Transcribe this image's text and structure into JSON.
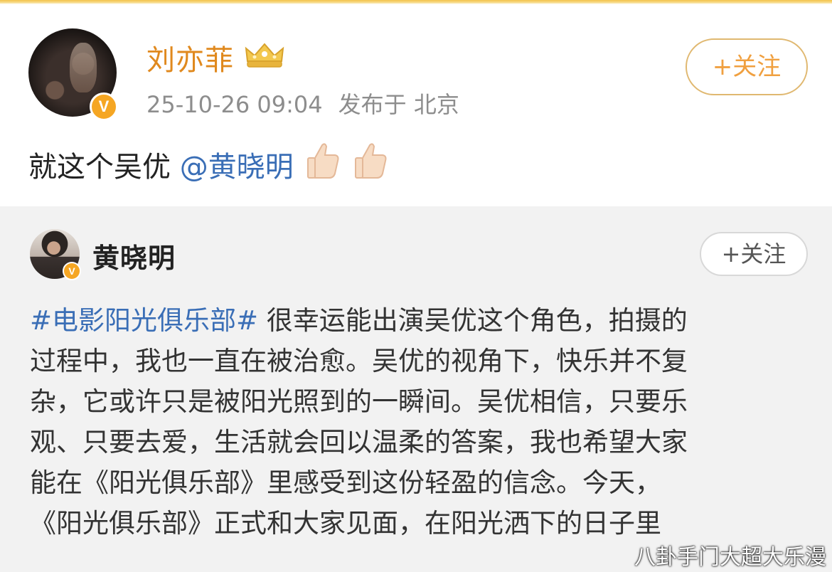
{
  "post": {
    "author": "刘亦菲",
    "time": "25-10-26 09:04",
    "location": "发布于 北京",
    "follow_label": "+关注",
    "text": "就这个吴优 ",
    "mention": "@黄晓明",
    "emojis": [
      "thumbs-up-icon",
      "thumbs-up-icon"
    ]
  },
  "repost": {
    "author": "黄晓明",
    "follow_label": "+关注",
    "hashtag": "#电影阳光俱乐部#",
    "lines": [
      " 很幸运能出演吴优这个角色，拍摄的",
      "过程中，我也一直在被治愈。吴优的视角下，快乐并不复",
      "杂，它或许只是被阳光照到的一瞬间。吴优相信，只要乐",
      "观、只要去爱，生活就会回以温柔的答案，我也希望大家",
      "能在《阳光俱乐部》里感受到这份轻盈的信念。今天，",
      "《阳光俱乐部》正式和大家见面，在阳光洒下的日子里"
    ]
  },
  "watermark": "八卦手门大超大乐漫",
  "colors": {
    "author_name": "#e0891e",
    "mention": "#3a6eb6",
    "follow_border": "#e0b870",
    "badge": "#f5a623",
    "repost_bg": "#f2f2f2"
  },
  "icons": {
    "vip": "crown-icon",
    "verified": "verified-badge-icon"
  }
}
